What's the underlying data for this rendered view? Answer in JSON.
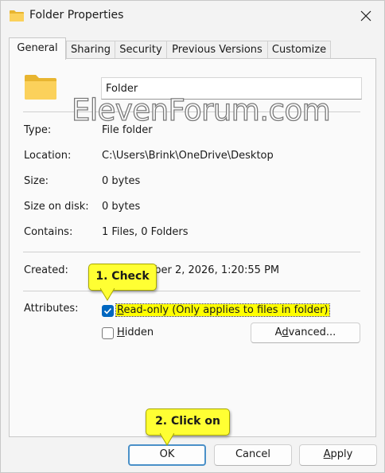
{
  "window": {
    "title": "Folder Properties"
  },
  "tabs": [
    {
      "label": "General"
    },
    {
      "label": "Sharing"
    },
    {
      "label": "Security"
    },
    {
      "label": "Previous Versions"
    },
    {
      "label": "Customize"
    }
  ],
  "general": {
    "folder_name": "Folder",
    "type_label": "Type:",
    "type_value": "File folder",
    "location_label": "Location:",
    "location_value": "C:\\Users\\Brink\\OneDrive\\Desktop",
    "size_label": "Size:",
    "size_value": "0 bytes",
    "size_on_disk_label": "Size on disk:",
    "size_on_disk_value": "0 bytes",
    "contains_label": "Contains:",
    "contains_value": "1 Files, 0 Folders",
    "created_label": "Created:",
    "created_value": "y, September 2, 2026, 1:20:55 PM",
    "attributes_label": "Attributes:",
    "readonly": {
      "prefix": "R",
      "rest": "ead-only (Only applies to files in folder)",
      "checked": true
    },
    "hidden": {
      "prefix": "H",
      "rest": "idden",
      "checked": false
    },
    "advanced_button": {
      "pre": "A",
      "u": "d",
      "post": "vanced..."
    }
  },
  "watermark": "ElevenForum.com",
  "footer": {
    "ok_label": "OK",
    "cancel_label": "Cancel",
    "apply_prefix": "A",
    "apply_rest": "pply"
  },
  "callouts": {
    "check": "1. Check",
    "click_on": "2. Click on",
    "color": "#ffff33"
  },
  "colors": {
    "accent": "#0067c0",
    "folder": "#f8c948"
  }
}
